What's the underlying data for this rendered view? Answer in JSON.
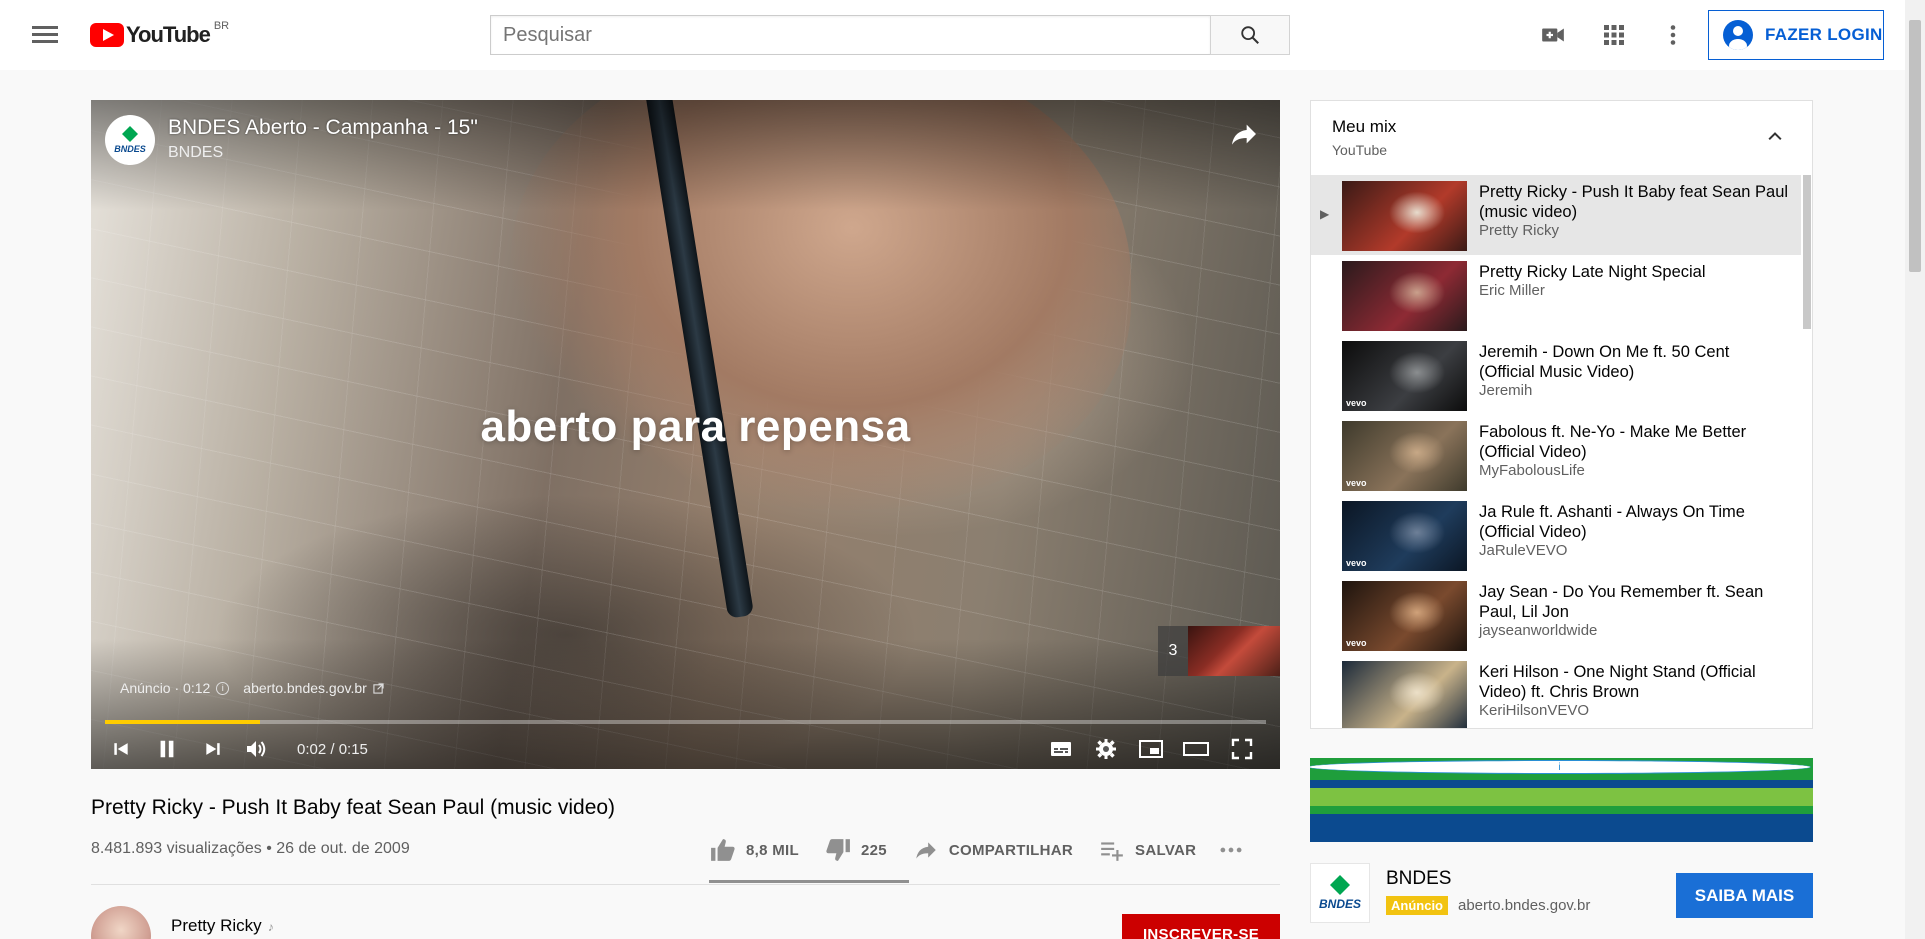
{
  "masthead": {
    "logo_text": "YouTube",
    "country_code": "BR",
    "search_placeholder": "Pesquisar",
    "login_label": "FAZER LOGIN"
  },
  "player": {
    "video_title": "BNDES Aberto - Campanha - 15\"",
    "channel_name": "BNDES",
    "channel_logo_text": "BNDES",
    "overlay_text": "aberto para repensa",
    "up_next_count": "3",
    "ad_label": "Anúncio · 0:12",
    "ad_link": "aberto.bndes.gov.br",
    "time": "0:02 / 0:15",
    "progress_fraction": 0.1333,
    "accent_color": "#ffcc00"
  },
  "watch": {
    "title": "Pretty Ricky - Push It Baby feat Sean Paul (music video)",
    "view_info": "8.481.893 visualizações • 26 de out. de 2009",
    "likes": "8,8 MIL",
    "dislikes": "225",
    "share_label": "COMPARTILHAR",
    "save_label": "SALVAR",
    "owner_name": "Pretty Ricky",
    "subscribe_label": "INSCREVER-SE"
  },
  "playlist": {
    "title": "Meu mix",
    "owner": "YouTube",
    "items": [
      {
        "title": "Pretty Ricky - Push It Baby feat Sean Paul (music video)",
        "channel": "Pretty Ricky",
        "thumb_colors": [
          "#3a1a16",
          "#b23a2a",
          "#e7dccd"
        ],
        "vevo": "",
        "active": true
      },
      {
        "title": "Pretty Ricky Late Night Special",
        "channel": "Eric Miller",
        "thumb_colors": [
          "#2a1a1c",
          "#8e2a34",
          "#c9a08c"
        ],
        "vevo": "",
        "active": false
      },
      {
        "title": "Jeremih - Down On Me ft. 50 Cent (Official Music Video)",
        "channel": "Jeremih",
        "thumb_colors": [
          "#0c0c0c",
          "#3c3e42",
          "#8b8e90"
        ],
        "vevo": "vevo",
        "active": false
      },
      {
        "title": "Fabolous ft. Ne-Yo - Make Me Better (Official Video)",
        "channel": "MyFabolousLife",
        "thumb_colors": [
          "#3e3a2c",
          "#8a735a",
          "#c7a886"
        ],
        "vevo": "vevo",
        "active": false
      },
      {
        "title": "Ja Rule ft. Ashanti - Always On Time (Official Video)",
        "channel": "JaRuleVEVO",
        "thumb_colors": [
          "#0b1624",
          "#1f3c5c",
          "#6e8098"
        ],
        "vevo": "vevo",
        "active": false
      },
      {
        "title": "Jay Sean - Do You Remember ft. Sean Paul, Lil Jon",
        "channel": "jayseanworldwide",
        "thumb_colors": [
          "#1e140e",
          "#7a4a2e",
          "#d0a27a"
        ],
        "vevo": "vevo",
        "active": false
      },
      {
        "title": "Keri Hilson - One Night Stand (Official Video) ft. Chris Brown",
        "channel": "KeriHilsonVEVO",
        "thumb_colors": [
          "#1c2a3a",
          "#c9b38a",
          "#ece0c8"
        ],
        "vevo": "",
        "active": false
      }
    ]
  },
  "ad_card": {
    "logo_text": "BNDES",
    "name": "BNDES",
    "badge": "Anúncio",
    "url": "aberto.bndes.gov.br",
    "cta": "SAIBA MAIS",
    "banner_colors": [
      "#1f9e3c",
      "#0b4a8f",
      "#7dc242",
      "#1f9e3c",
      "#0b4a8f"
    ]
  }
}
